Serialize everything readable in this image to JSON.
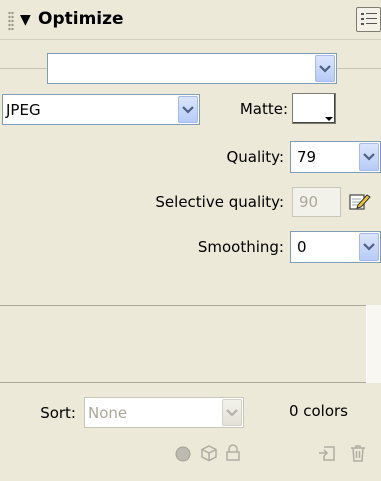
{
  "panel": {
    "title": "Optimize"
  },
  "settings": {
    "preset_value": "",
    "format_value": "JPEG",
    "matte_label": "Matte:",
    "matte_color": "#ffffff",
    "quality_label": "Quality:",
    "quality_value": "79",
    "selective_quality_label": "Selective quality:",
    "selective_quality_value": "90",
    "smoothing_label": "Smoothing:",
    "smoothing_value": "0"
  },
  "footer": {
    "sort_label": "Sort:",
    "sort_value": "None",
    "colors_count": "0 colors"
  },
  "icons": {
    "panel_options": "panel-options-icon",
    "edit_selective": "edit-pencil-icon",
    "transparent": "transparent-circle-icon",
    "snap_to_web": "cube-icon",
    "lock": "lock-icon",
    "add_color": "add-color-icon",
    "delete_color": "trash-icon"
  },
  "colors": {
    "panel_bg": "#ece9d8",
    "field_border": "#7f9db9",
    "dropdown_button": "#b6cbf6",
    "disabled_text": "#aca899"
  }
}
